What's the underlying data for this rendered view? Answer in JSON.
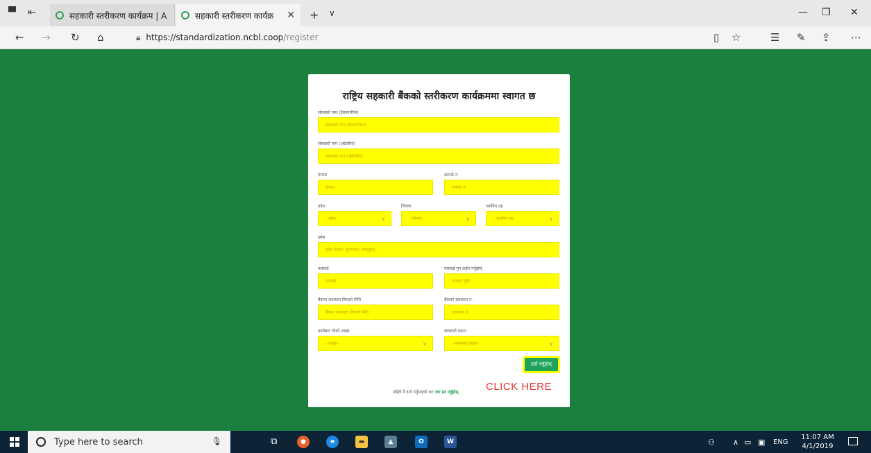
{
  "browser": {
    "tabs": [
      {
        "label": "सहकारी स्तरीकरण कार्यक्रम | A",
        "active": false
      },
      {
        "label": "सहकारी स्तरीकरण कार्यक्र",
        "active": true
      }
    ],
    "url_host": "https://standardization.ncbl.coop",
    "url_path": "/register"
  },
  "form": {
    "title": "राष्ट्रिय सहकारी बैंकको स्तरीकरण कार्यक्रममा स्वागत छ",
    "org_name_np_label": "संस्थाको नाम (देवनागरीमा)",
    "org_name_np_placeholder": "संस्थाको नाम (देवनागरीमा)",
    "org_name_en_label": "संस्थाको नाम (अंग्रेजीमा)",
    "org_name_en_placeholder": "संस्थाको नाम (अंग्रेजीमा)",
    "address_label": "ठेगाना",
    "address_placeholder": "ठेगाना",
    "contact_label": "सम्पर्क नं.",
    "contact_placeholder": "सम्पर्क नं.",
    "province_label": "प्रदेश",
    "province_value": "--प्रदेश--",
    "district_label": "जिल्ला",
    "district_value": "--जिल्ला--",
    "local_label": "स्थानिय तह",
    "local_value": "--स्थानिय तह--",
    "email_label": "इमेल",
    "email_placeholder": "इमेल ठेगाना (युजरनेम) राख्नुहोस्",
    "password_label": "पासवर्ड",
    "password_placeholder": "पासवर्ड",
    "password_confirm_label": "पासवर्ड पुन टाईप गर्नुहोस्",
    "password_confirm_placeholder": "पासवर्ड पुष्टि",
    "membership_date_label": "बैंकमा सदस्यता लिएको मिति",
    "membership_date_placeholder": "बैंकमा सदस्यता लिएको मिति",
    "membership_no_label": "बैंकको सदस्यता नं.",
    "membership_no_placeholder": "सदस्यता नं.",
    "transaction_label": "कारोबार गरेको शाखा",
    "transaction_value": "--शाखा--",
    "org_type_label": "संस्थाको प्रकार",
    "org_type_value": "--संस्थाको प्रकार--",
    "submit_label": "दर्ता गर्नुहोस्",
    "login_prompt": "पहिले नै दर्ता गर्नुभएको छ?",
    "login_link": "लग इन गर्नुहोस्",
    "annotation": "CLICK HERE"
  },
  "taskbar": {
    "search_placeholder": "Type here to search",
    "lang": "ENG",
    "time": "11:07 AM",
    "date": "4/1/2019"
  },
  "colors": {
    "background": "#1b7f3f",
    "field": "#ffff00",
    "button": "#1fa35a",
    "annotation": "#e3342f"
  }
}
